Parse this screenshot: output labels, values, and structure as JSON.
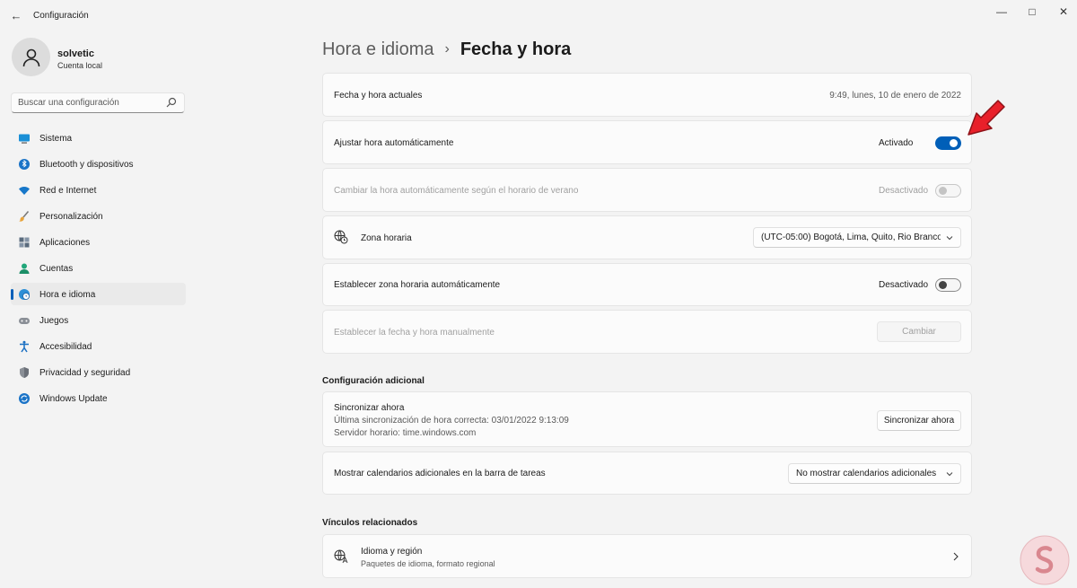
{
  "window": {
    "title": "Configuración"
  },
  "user": {
    "name": "solvetic",
    "account_type": "Cuenta local"
  },
  "search": {
    "placeholder": "Buscar una configuración"
  },
  "sidebar": {
    "items": [
      {
        "label": "Sistema",
        "icon": "monitor-icon",
        "active": false
      },
      {
        "label": "Bluetooth y dispositivos",
        "icon": "bluetooth-icon",
        "active": false
      },
      {
        "label": "Red e Internet",
        "icon": "wifi-icon",
        "active": false
      },
      {
        "label": "Personalización",
        "icon": "brush-icon",
        "active": false
      },
      {
        "label": "Aplicaciones",
        "icon": "apps-icon",
        "active": false
      },
      {
        "label": "Cuentas",
        "icon": "person-icon",
        "active": false
      },
      {
        "label": "Hora e idioma",
        "icon": "globe-clock-icon",
        "active": true
      },
      {
        "label": "Juegos",
        "icon": "gamepad-icon",
        "active": false
      },
      {
        "label": "Accesibilidad",
        "icon": "accessibility-icon",
        "active": false
      },
      {
        "label": "Privacidad y seguridad",
        "icon": "shield-icon",
        "active": false
      },
      {
        "label": "Windows Update",
        "icon": "update-icon",
        "active": false
      }
    ]
  },
  "header": {
    "parent": "Hora e idioma",
    "separator": "›",
    "current": "Fecha y hora"
  },
  "settings": {
    "current_datetime": {
      "label": "Fecha y hora actuales",
      "value": "9:49, lunes, 10 de enero de 2022"
    },
    "auto_time": {
      "label": "Ajustar hora automáticamente",
      "state": "Activado",
      "on": true
    },
    "dst": {
      "label": "Cambiar la hora automáticamente según el horario de verano",
      "state": "Desactivado",
      "on": false
    },
    "timezone": {
      "label": "Zona horaria",
      "value": "(UTC-05:00) Bogotá, Lima, Quito, Rio Branco"
    },
    "auto_timezone": {
      "label": "Establecer zona horaria automáticamente",
      "state": "Desactivado",
      "on": false
    },
    "manual": {
      "label": "Establecer la fecha y hora manualmente",
      "button": "Cambiar"
    }
  },
  "additional": {
    "title": "Configuración adicional",
    "sync": {
      "label": "Sincronizar ahora",
      "last_sync": "Última sincronización de hora correcta: 03/01/2022 9:13:09",
      "server": "Servidor horario: time.windows.com",
      "button": "Sincronizar ahora"
    },
    "calendars": {
      "label": "Mostrar calendarios adicionales en la barra de tareas",
      "value": "No mostrar calendarios adicionales"
    }
  },
  "related": {
    "title": "Vínculos relacionados",
    "language_region": {
      "label": "Idioma y región",
      "description": "Paquetes de idioma, formato regional"
    }
  },
  "colors": {
    "accent": "#005fb8",
    "pointer_arrow": "#e8202a",
    "background": "#f3f3f3"
  }
}
